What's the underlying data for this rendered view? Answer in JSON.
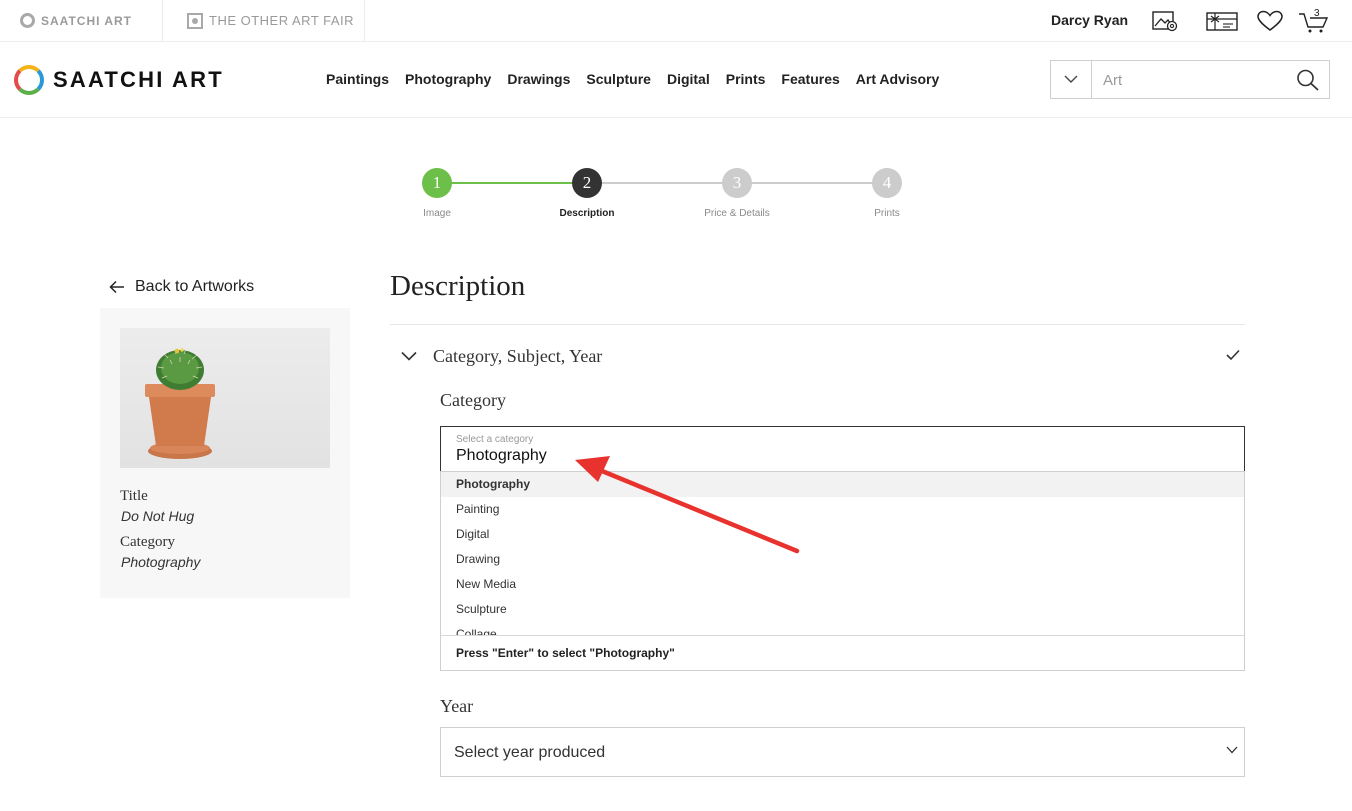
{
  "topbar": {
    "saatchi_tab": "SAATCHI ART",
    "other_fair_tab": "THE OTHER ART FAIR",
    "user_name": "Darcy Ryan",
    "cart_count": "3"
  },
  "nav": {
    "logo_text": "SAATCHI ART",
    "links": [
      "Paintings",
      "Photography",
      "Drawings",
      "Sculpture",
      "Digital",
      "Prints",
      "Features",
      "Art Advisory"
    ],
    "search_placeholder": "Art"
  },
  "stepper": {
    "steps": [
      {
        "number": "1",
        "label": "Image",
        "state": "complete"
      },
      {
        "number": "2",
        "label": "Description",
        "state": "active"
      },
      {
        "number": "3",
        "label": "Price & Details",
        "state": "pending"
      },
      {
        "number": "4",
        "label": "Prints",
        "state": "pending"
      }
    ],
    "colors": {
      "complete": "#6cc04a",
      "active": "#333333",
      "pending": "#cccccc"
    }
  },
  "sidebar": {
    "back_label": "Back to Artworks",
    "title_label": "Title",
    "title_value": "Do Not Hug",
    "category_label": "Category",
    "category_value": "Photography"
  },
  "form": {
    "heading": "Description",
    "section_title": "Category, Subject, Year",
    "category_label": "Category",
    "category_placeholder": "Select a category",
    "category_value": "Photography",
    "category_options": [
      "Photography",
      "Painting",
      "Digital",
      "Drawing",
      "New Media",
      "Sculpture",
      "Collage"
    ],
    "enter_hint": "Press \"Enter\" to select \"Photography\"",
    "year_label": "Year",
    "year_placeholder": "Select year produced"
  },
  "annotation": {
    "arrow_color": "#e8322d"
  }
}
